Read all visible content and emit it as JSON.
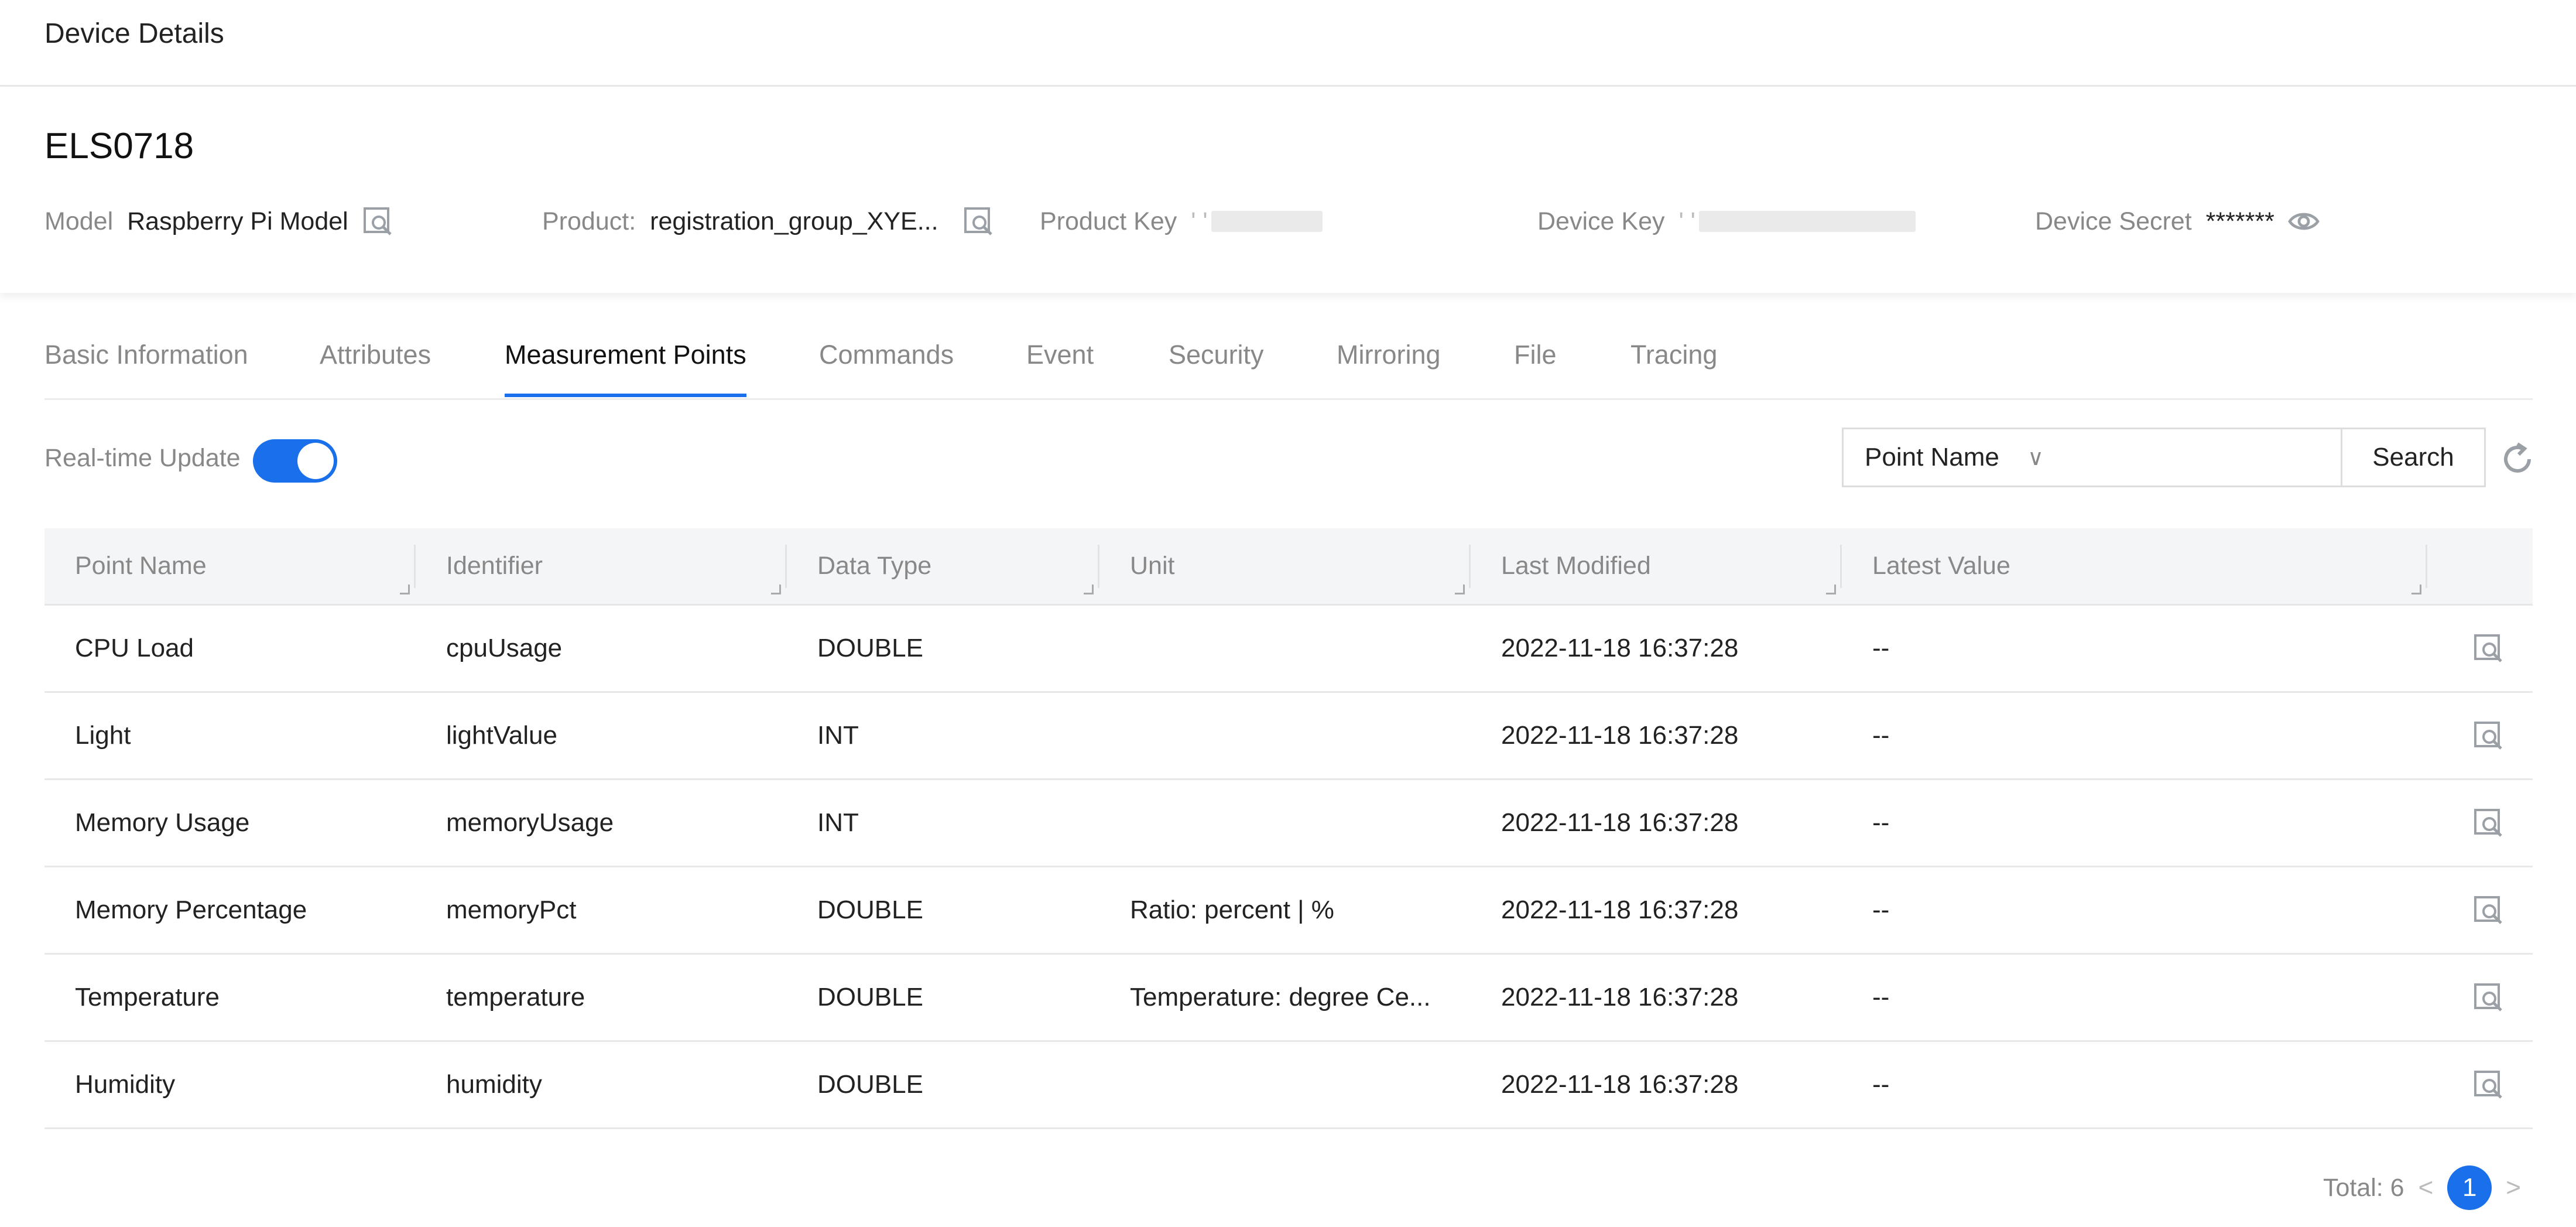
{
  "header": {
    "title": "Device Details"
  },
  "device": {
    "name": "ELS0718",
    "model_label": "Model",
    "model_value": "Raspberry Pi Model",
    "product_label": "Product:",
    "product_value": "registration_group_XYE...",
    "product_key_label": "Product Key",
    "product_key_value": "' '",
    "device_key_label": "Device Key",
    "device_key_value": "' '",
    "device_secret_label": "Device Secret",
    "device_secret_value": "*******"
  },
  "tabs": [
    {
      "label": "Basic Information",
      "active": false
    },
    {
      "label": "Attributes",
      "active": false
    },
    {
      "label": "Measurement Points",
      "active": true
    },
    {
      "label": "Commands",
      "active": false
    },
    {
      "label": "Event",
      "active": false
    },
    {
      "label": "Security",
      "active": false
    },
    {
      "label": "Mirroring",
      "active": false
    },
    {
      "label": "File",
      "active": false
    },
    {
      "label": "Tracing",
      "active": false
    }
  ],
  "toolbar": {
    "realtime_label": "Real-time Update",
    "realtime_on": true,
    "filter_field": "Point Name",
    "search_value": "",
    "search_label": "Search"
  },
  "table": {
    "columns": [
      "Point Name",
      "Identifier",
      "Data Type",
      "Unit",
      "Last Modified",
      "Latest Value"
    ],
    "rows": [
      {
        "name": "CPU Load",
        "identifier": "cpuUsage",
        "type": "DOUBLE",
        "unit": "",
        "modified": "2022-11-18 16:37:28",
        "latest": "--"
      },
      {
        "name": "Light",
        "identifier": "lightValue",
        "type": "INT",
        "unit": "",
        "modified": "2022-11-18 16:37:28",
        "latest": "--"
      },
      {
        "name": "Memory Usage",
        "identifier": "memoryUsage",
        "type": "INT",
        "unit": "",
        "modified": "2022-11-18 16:37:28",
        "latest": "--"
      },
      {
        "name": "Memory Percentage",
        "identifier": "memoryPct",
        "type": "DOUBLE",
        "unit": "Ratio: percent | %",
        "modified": "2022-11-18 16:37:28",
        "latest": "--"
      },
      {
        "name": "Temperature",
        "identifier": "temperature",
        "type": "DOUBLE",
        "unit": "Temperature: degree Ce...",
        "modified": "2022-11-18 16:37:28",
        "latest": "--"
      },
      {
        "name": "Humidity",
        "identifier": "humidity",
        "type": "DOUBLE",
        "unit": "",
        "modified": "2022-11-18 16:37:28",
        "latest": "--"
      }
    ]
  },
  "pagination": {
    "total_label": "Total: 6",
    "current_page": "1"
  },
  "colors": {
    "accent": "#1a6fea"
  }
}
